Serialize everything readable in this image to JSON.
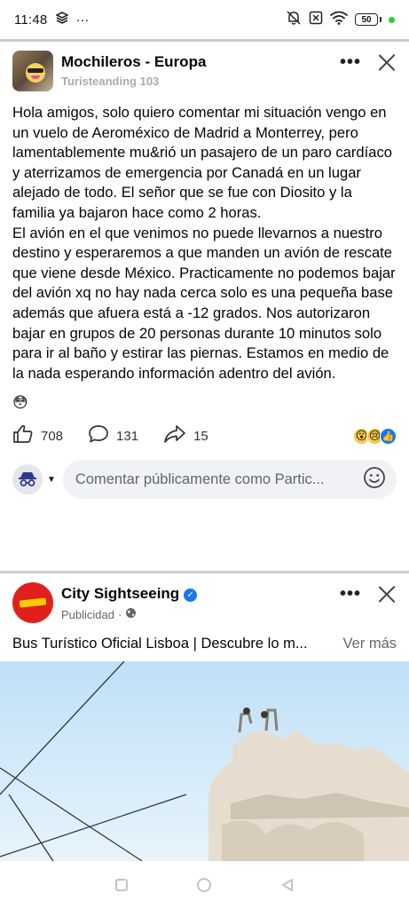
{
  "status_bar": {
    "time": "11:48",
    "extra": "···",
    "battery": "50"
  },
  "post1": {
    "group_name": "Mochileros - Europa",
    "author": "Turisteanding 103",
    "body_paragraphs": [
      "Hola amigos, solo quiero comentar mi situación vengo en un vuelo de Aeroméxico de Madrid a Monterrey, pero lamentablemente mu&rió un pasajero de un paro cardíaco y aterrizamos de emergencia por Canadá en un lugar alejado de todo. El señor que se fue con Diosito y la familia ya bajaron hace como 2 horas.",
      "El avión en el que venimos no puede llevarnos a nuestro destino y esperaremos a que manden un avión de rescate que viene desde México. Practicamente no podemos bajar del avión xq no hay nada cerca solo es una pequeña base además que afuera está a -12 grados. Nos autorizaron bajar en grupos de 20 personas durante 10 minutos solo para ir al baño y estirar las piernas. Estamos en medio de la nada esperando información adentro del avión."
    ],
    "emoji": "😳",
    "likes": "708",
    "comments": "131",
    "shares": "15",
    "reaction_icons": [
      "😮",
      "😢",
      "👍"
    ],
    "comment_placeholder": "Comentar públicamente como Partic..."
  },
  "post2": {
    "page_name": "City Sightseeing",
    "label": "Publicidad",
    "separator": "·",
    "ad_text": "Bus Turístico Oficial Lisboa | Descubre lo m...",
    "see_more": "Ver más"
  },
  "colors": {
    "accent": "#1877f2",
    "brand_red": "#e0201c",
    "divider": "#c9ccd1"
  }
}
